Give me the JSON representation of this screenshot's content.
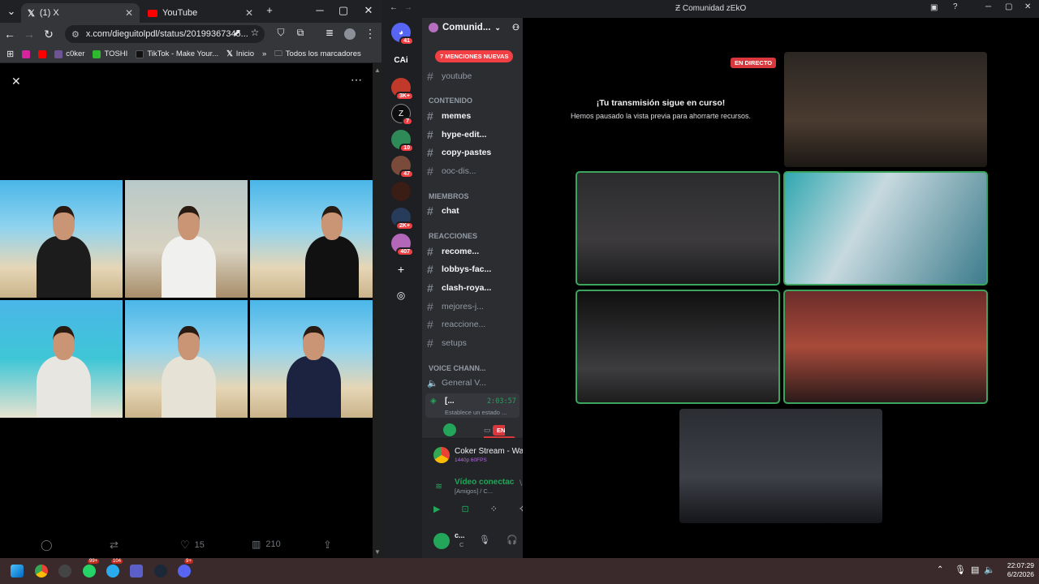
{
  "chrome": {
    "tabs": [
      {
        "title": "(1) X",
        "icon": "x-logo-icon"
      },
      {
        "title": "YouTube",
        "icon": "youtube-icon"
      }
    ],
    "new_tab": "+",
    "url": "x.com/dieguitolpdl/status/20199367345...",
    "bookmarks": [
      "c0ker",
      "TOSHI",
      "TikTok - Make Your...",
      "Inicio"
    ],
    "bookmarks_overflow": "»",
    "all_bookmarks": "Todos los marcadores"
  },
  "tweet": {
    "likes": "15",
    "views": "210"
  },
  "discord": {
    "window_title": "Comunidad zEkO",
    "server_name": "Comunid...",
    "mentions_banner": "7 MENCIONES NUEVAS",
    "servers": [
      {
        "label": "",
        "badge": "41"
      },
      {
        "label": "CAi",
        "badge": ""
      },
      {
        "label": "",
        "badge": "3K+"
      },
      {
        "label": "Z",
        "badge": "7"
      },
      {
        "label": "",
        "badge": "10"
      },
      {
        "label": "",
        "badge": "47"
      },
      {
        "label": "",
        "badge": ""
      },
      {
        "label": "",
        "badge": "2K+"
      },
      {
        "label": "",
        "badge": "407"
      }
    ],
    "channels": [
      {
        "name": "youtube",
        "unread": false,
        "kind": "text"
      },
      {
        "name": "CONTENIDO",
        "kind": "category"
      },
      {
        "name": "memes",
        "unread": true,
        "kind": "text"
      },
      {
        "name": "hype-edit...",
        "unread": true,
        "kind": "text"
      },
      {
        "name": "copy-pastes",
        "unread": true,
        "kind": "text"
      },
      {
        "name": "ooc-dis...",
        "unread": false,
        "kind": "text"
      },
      {
        "name": "MIEMBROS",
        "kind": "category"
      },
      {
        "name": "chat",
        "unread": true,
        "kind": "text"
      },
      {
        "name": "REACCIONES",
        "kind": "category"
      },
      {
        "name": "recome...",
        "unread": true,
        "kind": "text"
      },
      {
        "name": "lobbys-fac...",
        "unread": true,
        "kind": "text"
      },
      {
        "name": "clash-roya...",
        "unread": true,
        "kind": "text"
      },
      {
        "name": "mejores-j...",
        "unread": false,
        "kind": "text"
      },
      {
        "name": "reaccione...",
        "unread": false,
        "kind": "text"
      },
      {
        "name": "setups",
        "unread": false,
        "kind": "text"
      },
      {
        "name": "VOICE CHANN...",
        "kind": "category"
      },
      {
        "name": "General V...",
        "unread": false,
        "kind": "voice"
      }
    ],
    "voice_entry": {
      "name": "[...",
      "timer": "2:03:57",
      "status": "Establece un estado ..."
    },
    "live_label": "EN DIRECTO",
    "stream_panel": {
      "title": "Coker Stream - Wa...",
      "quality": "1440p 60FPS"
    },
    "voice_panel": {
      "status": "Vídeo conectac",
      "channel": "[Amigos] / C..."
    },
    "user_panel": {
      "name": "c...",
      "status": "C"
    },
    "paused": {
      "title": "¡Tu transmisión sigue en curso!",
      "subtitle": "Hemos pausado la vista previa para ahorrarte recursos."
    }
  },
  "taskbar": {
    "time": "22:07:29",
    "date": "6/2/2026",
    "badges": [
      "99+",
      "104",
      "9+"
    ]
  }
}
